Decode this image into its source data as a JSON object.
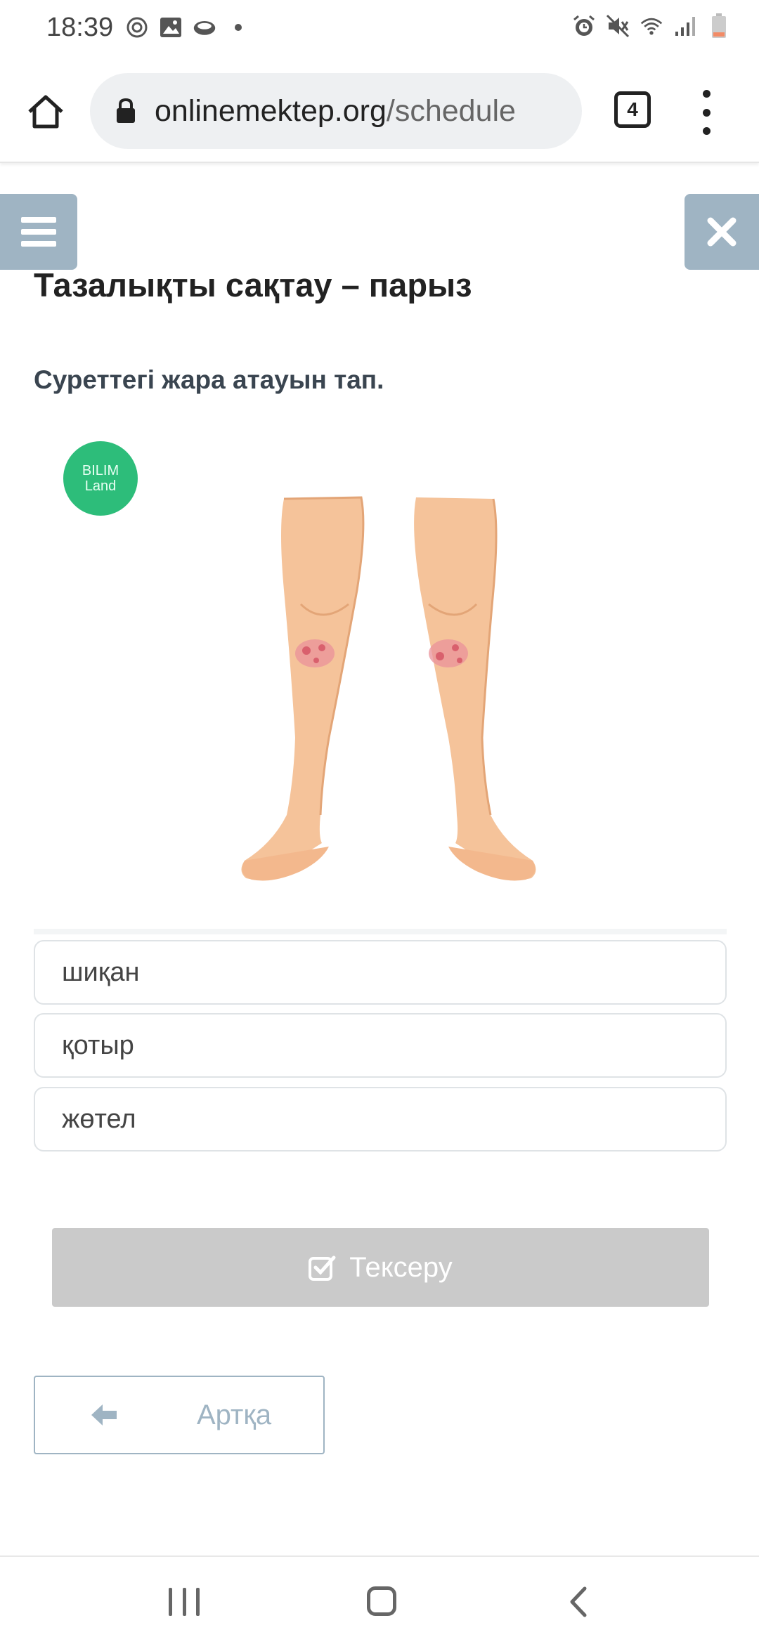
{
  "status_bar": {
    "time": "18:39"
  },
  "browser": {
    "url_domain": "onlinemektep.org",
    "url_path": "/schedule",
    "tab_count": "4"
  },
  "page": {
    "title": "Тазалықты сақтау – парыз",
    "question": "Суреттегі жара атауын тап.",
    "logo_line1": "BILIM",
    "logo_line2": "Land",
    "options": [
      {
        "label": "шиқан"
      },
      {
        "label": "қотыр"
      },
      {
        "label": "жөтел"
      }
    ],
    "check_button": "Тексеру",
    "back_button": "Артқа"
  },
  "colors": {
    "accent_gray_blue": "#9fb4c3",
    "disabled_button": "#cacaca",
    "logo_green": "#2dbd7a"
  },
  "icons": {
    "status_left": [
      "target-icon",
      "image-icon",
      "cloud-icon",
      "dot-icon"
    ],
    "status_right": [
      "alarm-icon",
      "mute-icon",
      "wifi-icon",
      "signal-icon",
      "battery-icon"
    ]
  }
}
